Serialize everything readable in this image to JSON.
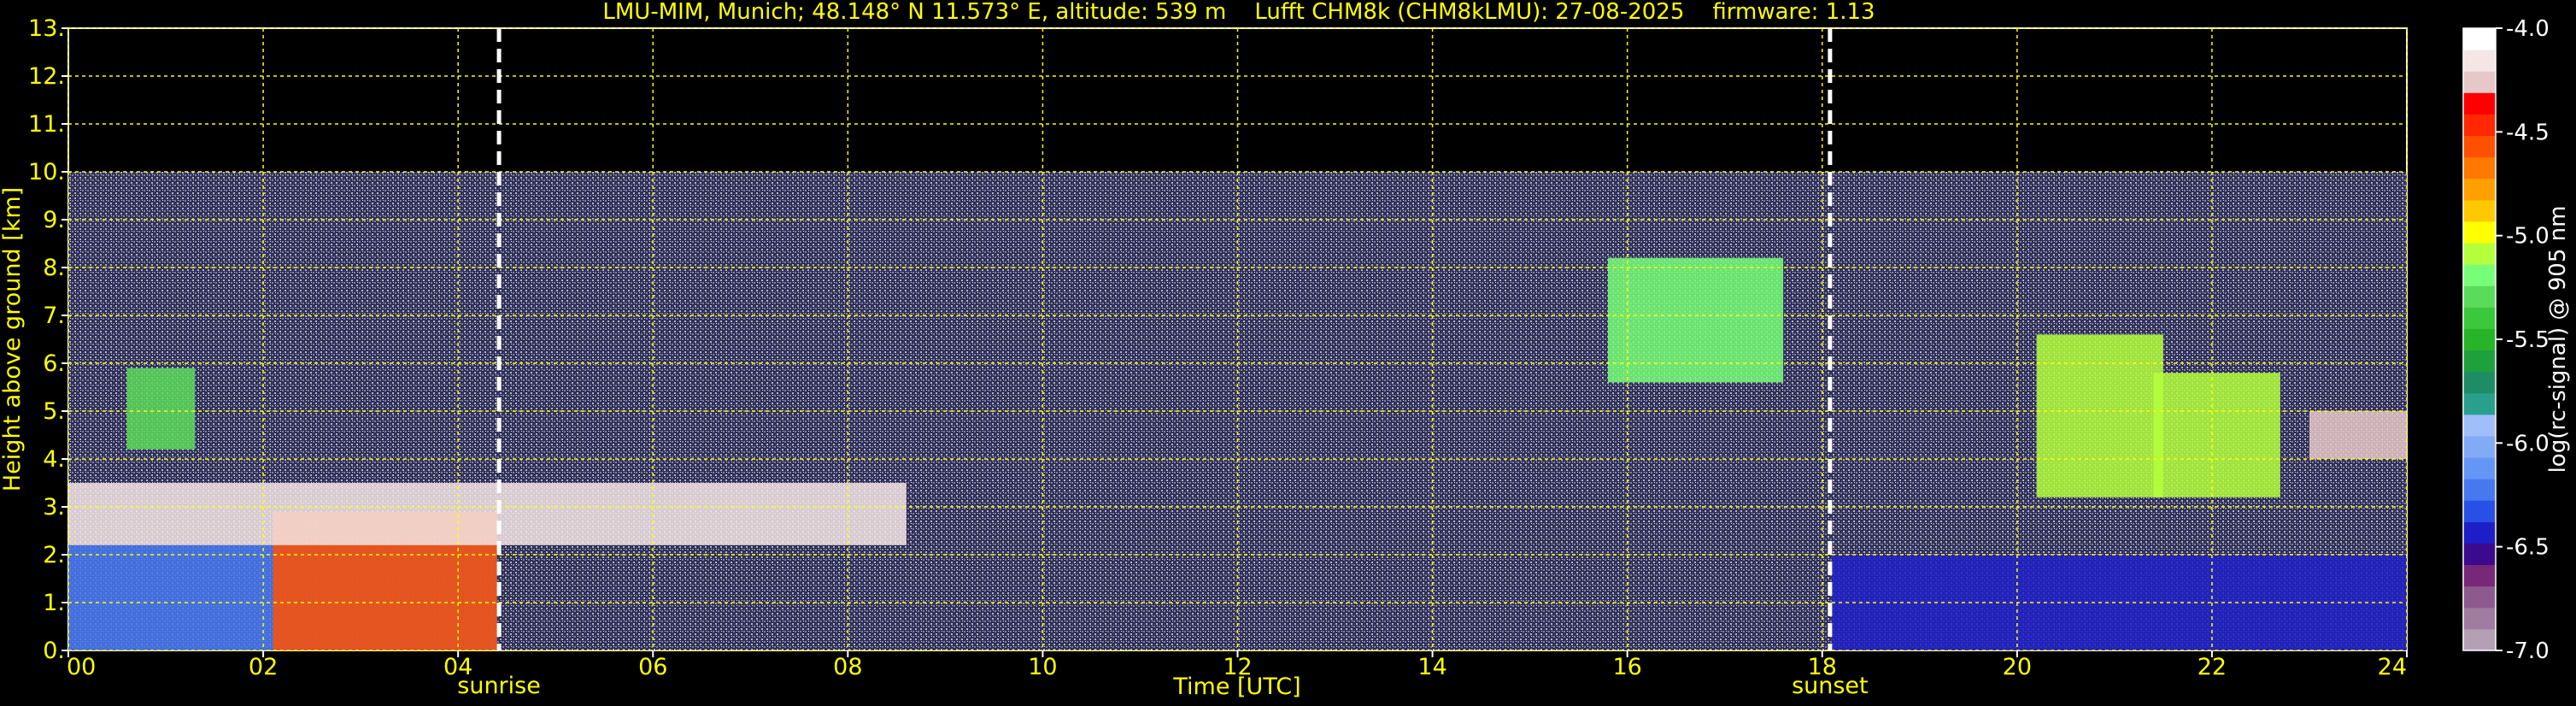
{
  "chart_data": {
    "type": "heatmap",
    "title": "LMU-MIM, Munich; 48.148° N 11.573° E, altitude: 539 m    Lufft CHM8k (CHM8kLMU): 27-08-2025    firmware: 1.13",
    "xlabel": "Time [UTC]",
    "ylabel": "Height above ground [km]",
    "xlim": [
      0,
      24
    ],
    "ylim": [
      0,
      13
    ],
    "data_top_km": 10,
    "grid": true,
    "x_ticks": [
      {
        "value": 0,
        "label": "00"
      },
      {
        "value": 2,
        "label": "02"
      },
      {
        "value": 4,
        "label": "04"
      },
      {
        "value": 6,
        "label": "06"
      },
      {
        "value": 8,
        "label": "08"
      },
      {
        "value": 10,
        "label": "10"
      },
      {
        "value": 12,
        "label": "12"
      },
      {
        "value": 14,
        "label": "14"
      },
      {
        "value": 16,
        "label": "16"
      },
      {
        "value": 18,
        "label": "18"
      },
      {
        "value": 20,
        "label": "20"
      },
      {
        "value": 22,
        "label": "22"
      },
      {
        "value": 24,
        "label": "24"
      }
    ],
    "y_ticks": [
      {
        "value": 0,
        "label": "0."
      },
      {
        "value": 1,
        "label": "1."
      },
      {
        "value": 2,
        "label": "2."
      },
      {
        "value": 3,
        "label": "3."
      },
      {
        "value": 4,
        "label": "4."
      },
      {
        "value": 5,
        "label": "5."
      },
      {
        "value": 6,
        "label": "6."
      },
      {
        "value": 7,
        "label": "7."
      },
      {
        "value": 8,
        "label": "8."
      },
      {
        "value": 9,
        "label": "9."
      },
      {
        "value": 10,
        "label": "10."
      },
      {
        "value": 11,
        "label": "11."
      },
      {
        "value": 12,
        "label": "12."
      },
      {
        "value": 13,
        "label": "13."
      }
    ],
    "markers": [
      {
        "name": "sunrise",
        "label": "sunrise",
        "x": 4.42
      },
      {
        "name": "sunset",
        "label": "sunset",
        "x": 18.08
      }
    ],
    "colorbar": {
      "label": "log(rc-signal) @ 905 nm",
      "range": [
        -7.0,
        -4.0
      ],
      "ticks": [
        {
          "value": -4.0,
          "label": "-4.0"
        },
        {
          "value": -4.5,
          "label": "-4.5"
        },
        {
          "value": -5.0,
          "label": "-5.0"
        },
        {
          "value": -5.5,
          "label": "-5.5"
        },
        {
          "value": -6.0,
          "label": "-6.0"
        },
        {
          "value": -6.5,
          "label": "-6.5"
        },
        {
          "value": -7.0,
          "label": "-7.0"
        }
      ],
      "colors_low_to_high": [
        "#b4a0b4",
        "#a07ca0",
        "#8c5a8c",
        "#782878",
        "#3c0a8c",
        "#1e1ec8",
        "#2850e6",
        "#4678f0",
        "#6496f5",
        "#82aaf5",
        "#a0befa",
        "#28a08c",
        "#1e8c64",
        "#1ea03c",
        "#28b428",
        "#3cc83c",
        "#5adc5a",
        "#78ff78",
        "#b4ff3c",
        "#ffff00",
        "#ffc800",
        "#ffa000",
        "#ff7800",
        "#ff5000",
        "#ff2800",
        "#ff0000",
        "#e6c8c8",
        "#f5e6e6",
        "#ffffff"
      ]
    },
    "features": [
      {
        "name": "night-boundary-layer-aerosol",
        "t_start": 0.0,
        "t_end": 4.4,
        "z_bottom": 0.0,
        "z_top": 2.2,
        "value": -6.2
      },
      {
        "name": "morning-low-cloud",
        "t_start": 2.1,
        "t_end": 4.4,
        "z_bottom": 0.0,
        "z_top": 2.9,
        "value": -4.6
      },
      {
        "name": "early-cirrus",
        "t_start": 0.6,
        "t_end": 1.3,
        "z_bottom": 4.2,
        "z_top": 5.9,
        "value": -5.3
      },
      {
        "name": "cloud-base-line-morning",
        "t_start": 0.0,
        "t_end": 8.6,
        "z_bottom": 2.2,
        "z_top": 3.5,
        "value": -4.2
      },
      {
        "name": "afternoon-cirrus-v",
        "t_start": 15.8,
        "t_end": 17.6,
        "z_bottom": 5.6,
        "z_top": 8.2,
        "value": -5.2
      },
      {
        "name": "evening-cirrus-1",
        "t_start": 20.2,
        "t_end": 21.5,
        "z_bottom": 3.2,
        "z_top": 6.6,
        "value": -5.1
      },
      {
        "name": "evening-cirrus-2",
        "t_start": 21.4,
        "t_end": 22.7,
        "z_bottom": 3.2,
        "z_top": 5.8,
        "value": -5.1
      },
      {
        "name": "evening-boundary-layer",
        "t_start": 18.1,
        "t_end": 24.0,
        "z_bottom": 0.0,
        "z_top": 2.0,
        "value": -6.4
      },
      {
        "name": "evening-cloud-base-points",
        "t_start": 23.0,
        "t_end": 24.0,
        "z_bottom": 4.0,
        "z_top": 5.0,
        "value": -4.3
      }
    ]
  }
}
